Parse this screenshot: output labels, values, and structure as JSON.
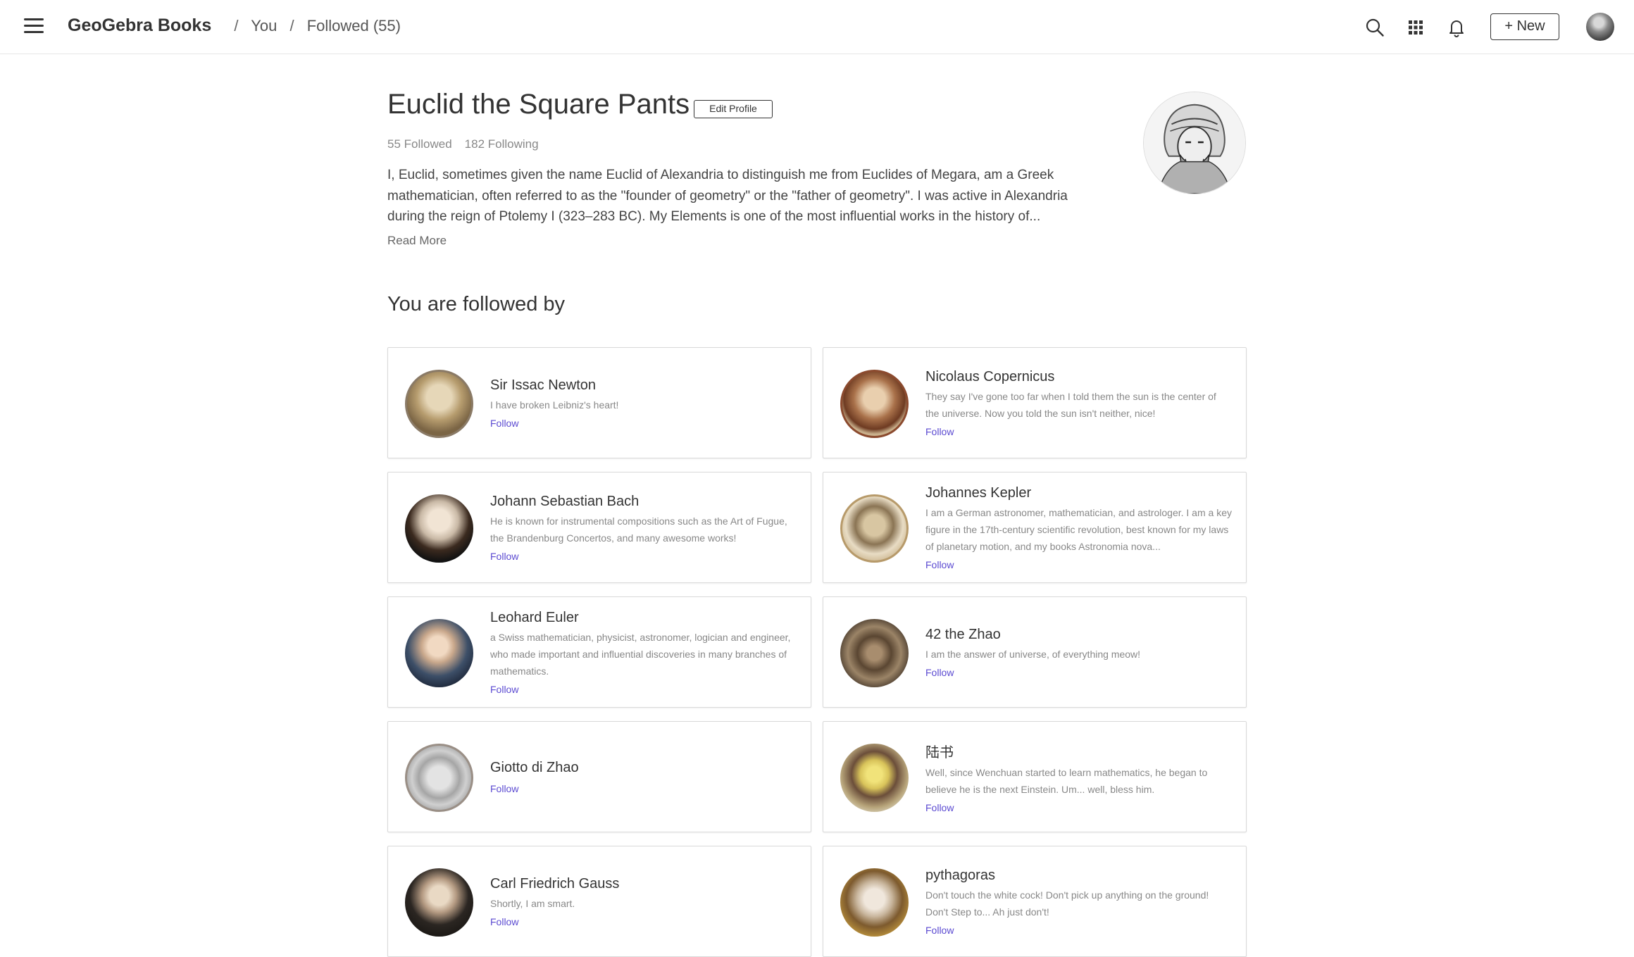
{
  "header": {
    "brand": "GeoGebra Books",
    "crumb_you": "You",
    "crumb_followed": "Followed (55)",
    "sep": "/",
    "new_label": "+ New"
  },
  "profile": {
    "name": "Euclid the Square Pants",
    "edit_label": "Edit Profile",
    "followed": "55 Followed",
    "following": "182 Following",
    "bio": "I, Euclid, sometimes given the name Euclid of Alexandria to distinguish me from Euclides of Megara, am a Greek mathematician, often referred to as the \"founder of geometry\" or the \"father of geometry\". I was active in Alexandria during the reign of Ptolemy I (323–283 BC). My Elements is one of the most influential works in the history of...",
    "read_more": "Read More"
  },
  "section_title": "You are followed by",
  "followers": [
    {
      "name": "Sir Issac Newton",
      "desc": "I have broken Leibniz's heart!",
      "follow": "Follow"
    },
    {
      "name": "Nicolaus Copernicus",
      "desc": "They say I've gone too far when I told them the sun is the center of the universe. Now you told the sun isn't neither, nice!",
      "follow": "Follow"
    },
    {
      "name": "Johann Sebastian Bach",
      "desc": "He is known for instrumental compositions such as the Art of Fugue, the Brandenburg Concertos, and many awesome works!",
      "follow": "Follow"
    },
    {
      "name": "Johannes Kepler",
      "desc": "I am a German astronomer, mathematician, and astrologer. I am a key figure in the 17th-century scientific revolution, best known for my laws of planetary motion, and my books Astronomia nova...",
      "follow": "Follow"
    },
    {
      "name": "Leohard Euler",
      "desc": "a Swiss mathematician, physicist, astronomer, logician and engineer, who made important and influential discoveries in many branches of mathematics.",
      "follow": "Follow"
    },
    {
      "name": "42 the Zhao",
      "desc": "I am the answer of universe, of everything meow!",
      "follow": "Follow"
    },
    {
      "name": "Giotto di Zhao",
      "desc": "",
      "follow": "Follow"
    },
    {
      "name": "陆书",
      "desc": "Well, since Wenchuan started to learn mathematics, he began to believe he is the next Einstein. Um... well, bless him.",
      "follow": "Follow"
    },
    {
      "name": "Carl Friedrich Gauss",
      "desc": "Shortly, I am smart.",
      "follow": "Follow"
    },
    {
      "name": "pythagoras",
      "desc": "Don't touch the white cock! Don't pick up anything on the ground! Don't Step to... Ah just don't!",
      "follow": "Follow"
    }
  ],
  "icons": {
    "menu": "menu-icon",
    "search": "search-icon",
    "apps": "apps-grid-icon",
    "notifications": "bell-icon"
  },
  "colors": {
    "follow_link": "#5b4ad1",
    "text": "#333333",
    "muted": "#888888",
    "border": "#d9d9d9"
  }
}
